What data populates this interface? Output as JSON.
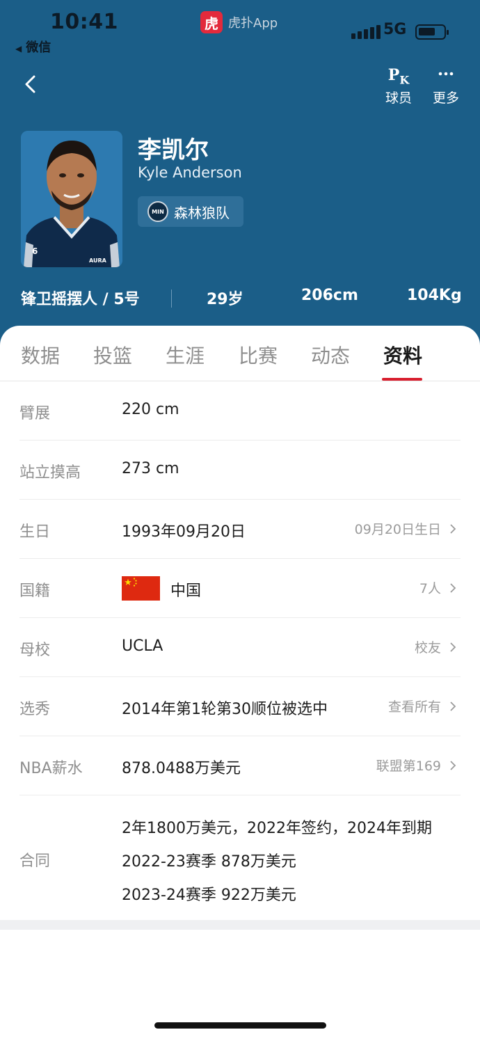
{
  "status_bar": {
    "time": "10:41",
    "back_app": "微信",
    "app_logo_char": "虎",
    "app_name": "虎扑App",
    "network": "5G"
  },
  "nav": {
    "pk_label": "球员",
    "more_label": "更多"
  },
  "player": {
    "name_cn": "李凯尔",
    "name_en": "Kyle Anderson",
    "team_logo_text": "MIN",
    "team": "森林狼队",
    "jersey_number": "6",
    "jersey_brand": "AURA"
  },
  "stats": {
    "position": "锋卫摇摆人 / 5号",
    "age": "29岁",
    "height": "206cm",
    "weight": "104Kg"
  },
  "tabs": [
    {
      "label": "数据"
    },
    {
      "label": "投篮"
    },
    {
      "label": "生涯"
    },
    {
      "label": "比赛"
    },
    {
      "label": "动态"
    },
    {
      "label": "资料"
    }
  ],
  "active_tab": "资料",
  "info": {
    "wingspan": {
      "key": "臂展",
      "value": "220 cm"
    },
    "reach": {
      "key": "站立摸高",
      "value": "273 cm"
    },
    "birthday": {
      "key": "生日",
      "value": "1993年09月20日",
      "right": "09月20日生日"
    },
    "nationality": {
      "key": "国籍",
      "value": "中国",
      "right": "7人"
    },
    "college": {
      "key": "母校",
      "value": "UCLA",
      "right": "校友"
    },
    "draft": {
      "key": "选秀",
      "value": "2014年第1轮第30顺位被选中",
      "right": "查看所有"
    },
    "salary": {
      "key": "NBA薪水",
      "value": "878.0488万美元",
      "right": "联盟第169"
    },
    "contract": {
      "key": "合同",
      "lines": [
        "2年1800万美元，2022年签约，2024年到期",
        "2022-23赛季 878万美元",
        "2023-24赛季 922万美元"
      ]
    }
  },
  "colors": {
    "header_bg": "#1b5e88",
    "accent_red": "#d81e2e",
    "flag_red": "#de2910",
    "flag_yellow": "#ffde00"
  }
}
